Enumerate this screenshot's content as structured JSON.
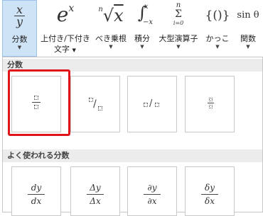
{
  "ribbon": {
    "buttons": [
      {
        "id": "fraction",
        "label": "分数",
        "label2": "",
        "active": true
      },
      {
        "id": "script",
        "label": "上付き/下付き",
        "label2": "文字",
        "active": false
      },
      {
        "id": "radical",
        "label": "べき乗根",
        "label2": "",
        "active": false
      },
      {
        "id": "integral",
        "label": "積分",
        "label2": "",
        "active": false
      },
      {
        "id": "large-operator",
        "label": "大型演算子",
        "label2": "",
        "active": false
      },
      {
        "id": "bracket",
        "label": "かっこ",
        "label2": "",
        "active": false
      },
      {
        "id": "function",
        "label": "関数",
        "label2": "",
        "active": false
      }
    ],
    "glyphs": {
      "fraction_num": "x",
      "fraction_den": "y",
      "script_base": "e",
      "script_sup": "x",
      "radical_index": "n",
      "radical_sign": "√",
      "radical_body": "x",
      "integral_sign": "∫",
      "integral_upper": "x",
      "integral_lower": "−x",
      "sum_upper": "n",
      "sum_sign": "Σ",
      "sum_lower": "i=0",
      "bracket": "{()}",
      "function": "sin θ"
    }
  },
  "gallery": {
    "section1_title": "分数",
    "section2_title": "よく使われる分数",
    "common_fractions": [
      {
        "num": "dy",
        "den": "dx"
      },
      {
        "num": "Δy",
        "den": "Δx"
      },
      {
        "num": "∂y",
        "den": "∂x"
      },
      {
        "num": "δy",
        "den": "δx"
      }
    ],
    "skewed_slash": "/",
    "linear_slash": "/"
  },
  "colors": {
    "active_button_bg": "#cfe3f7",
    "highlight_border": "#e0151b",
    "section_header_bg": "#ececec"
  }
}
